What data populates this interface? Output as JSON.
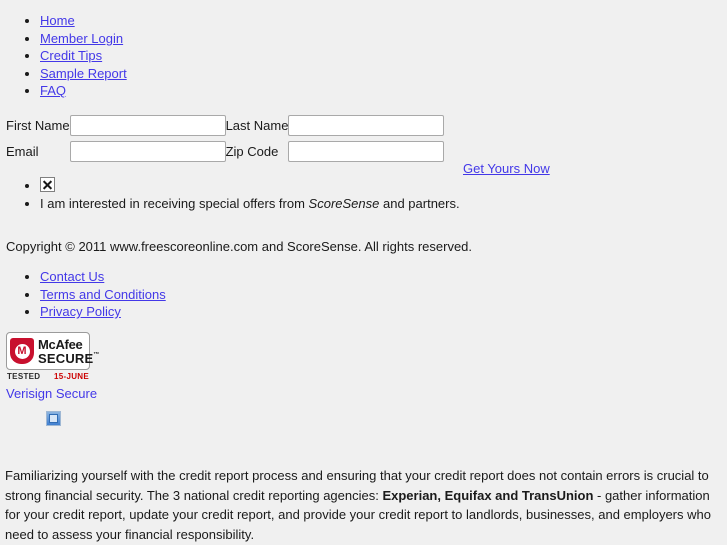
{
  "top_nav": {
    "items": [
      {
        "label": "Home"
      },
      {
        "label": "Member Login"
      },
      {
        "label": "Credit Tips"
      },
      {
        "label": "Sample Report"
      },
      {
        "label": "FAQ"
      }
    ]
  },
  "form": {
    "first_name_label": "First Name",
    "first_name_value": "",
    "last_name_label": "Last Name",
    "last_name_value": "",
    "email_label": "Email",
    "email_value": "",
    "zip_label": "Zip Code",
    "zip_value": "",
    "submit_label": "Get Yours Now"
  },
  "offers": {
    "checkbox_icon": "broken-image-icon",
    "text_before": "I am interested in receiving special offers from ",
    "brand": "ScoreSense",
    "text_after": " and partners."
  },
  "copyright": {
    "text": "Copyright © 2011 www.freescoreonline.com and ScoreSense. All rights reserved."
  },
  "footer_links": {
    "items": [
      {
        "label": "Contact Us"
      },
      {
        "label": "Terms and Conditions"
      },
      {
        "label": "Privacy Policy"
      }
    ]
  },
  "badges": {
    "mcafee": {
      "shield_letter": "M",
      "line1": "McAfee",
      "line2": "SECURE",
      "trademark": "™",
      "tested_label": "TESTED",
      "tested_date": "15-JUNE",
      "shield_color": "#c8102e",
      "date_color": "#cc0000"
    },
    "verisign_label": "Verisign Secure",
    "small_icon": "broken-image-icon"
  },
  "bottom_paragraph": {
    "part1": "Familiarizing yourself with the credit report process and ensuring that your credit report does not contain errors is crucial to strong financial security. The 3 national credit reporting agencies: ",
    "agencies": "Experian, Equifax and TransUnion",
    "part2": " - gather information for your credit report, update your credit report, and provide your credit report to landlords, businesses, and employers who need to assess your financial responsibility."
  },
  "colors": {
    "page_background": "#f0f0f0",
    "link": "#4338e8",
    "text": "#1a1a1a"
  }
}
